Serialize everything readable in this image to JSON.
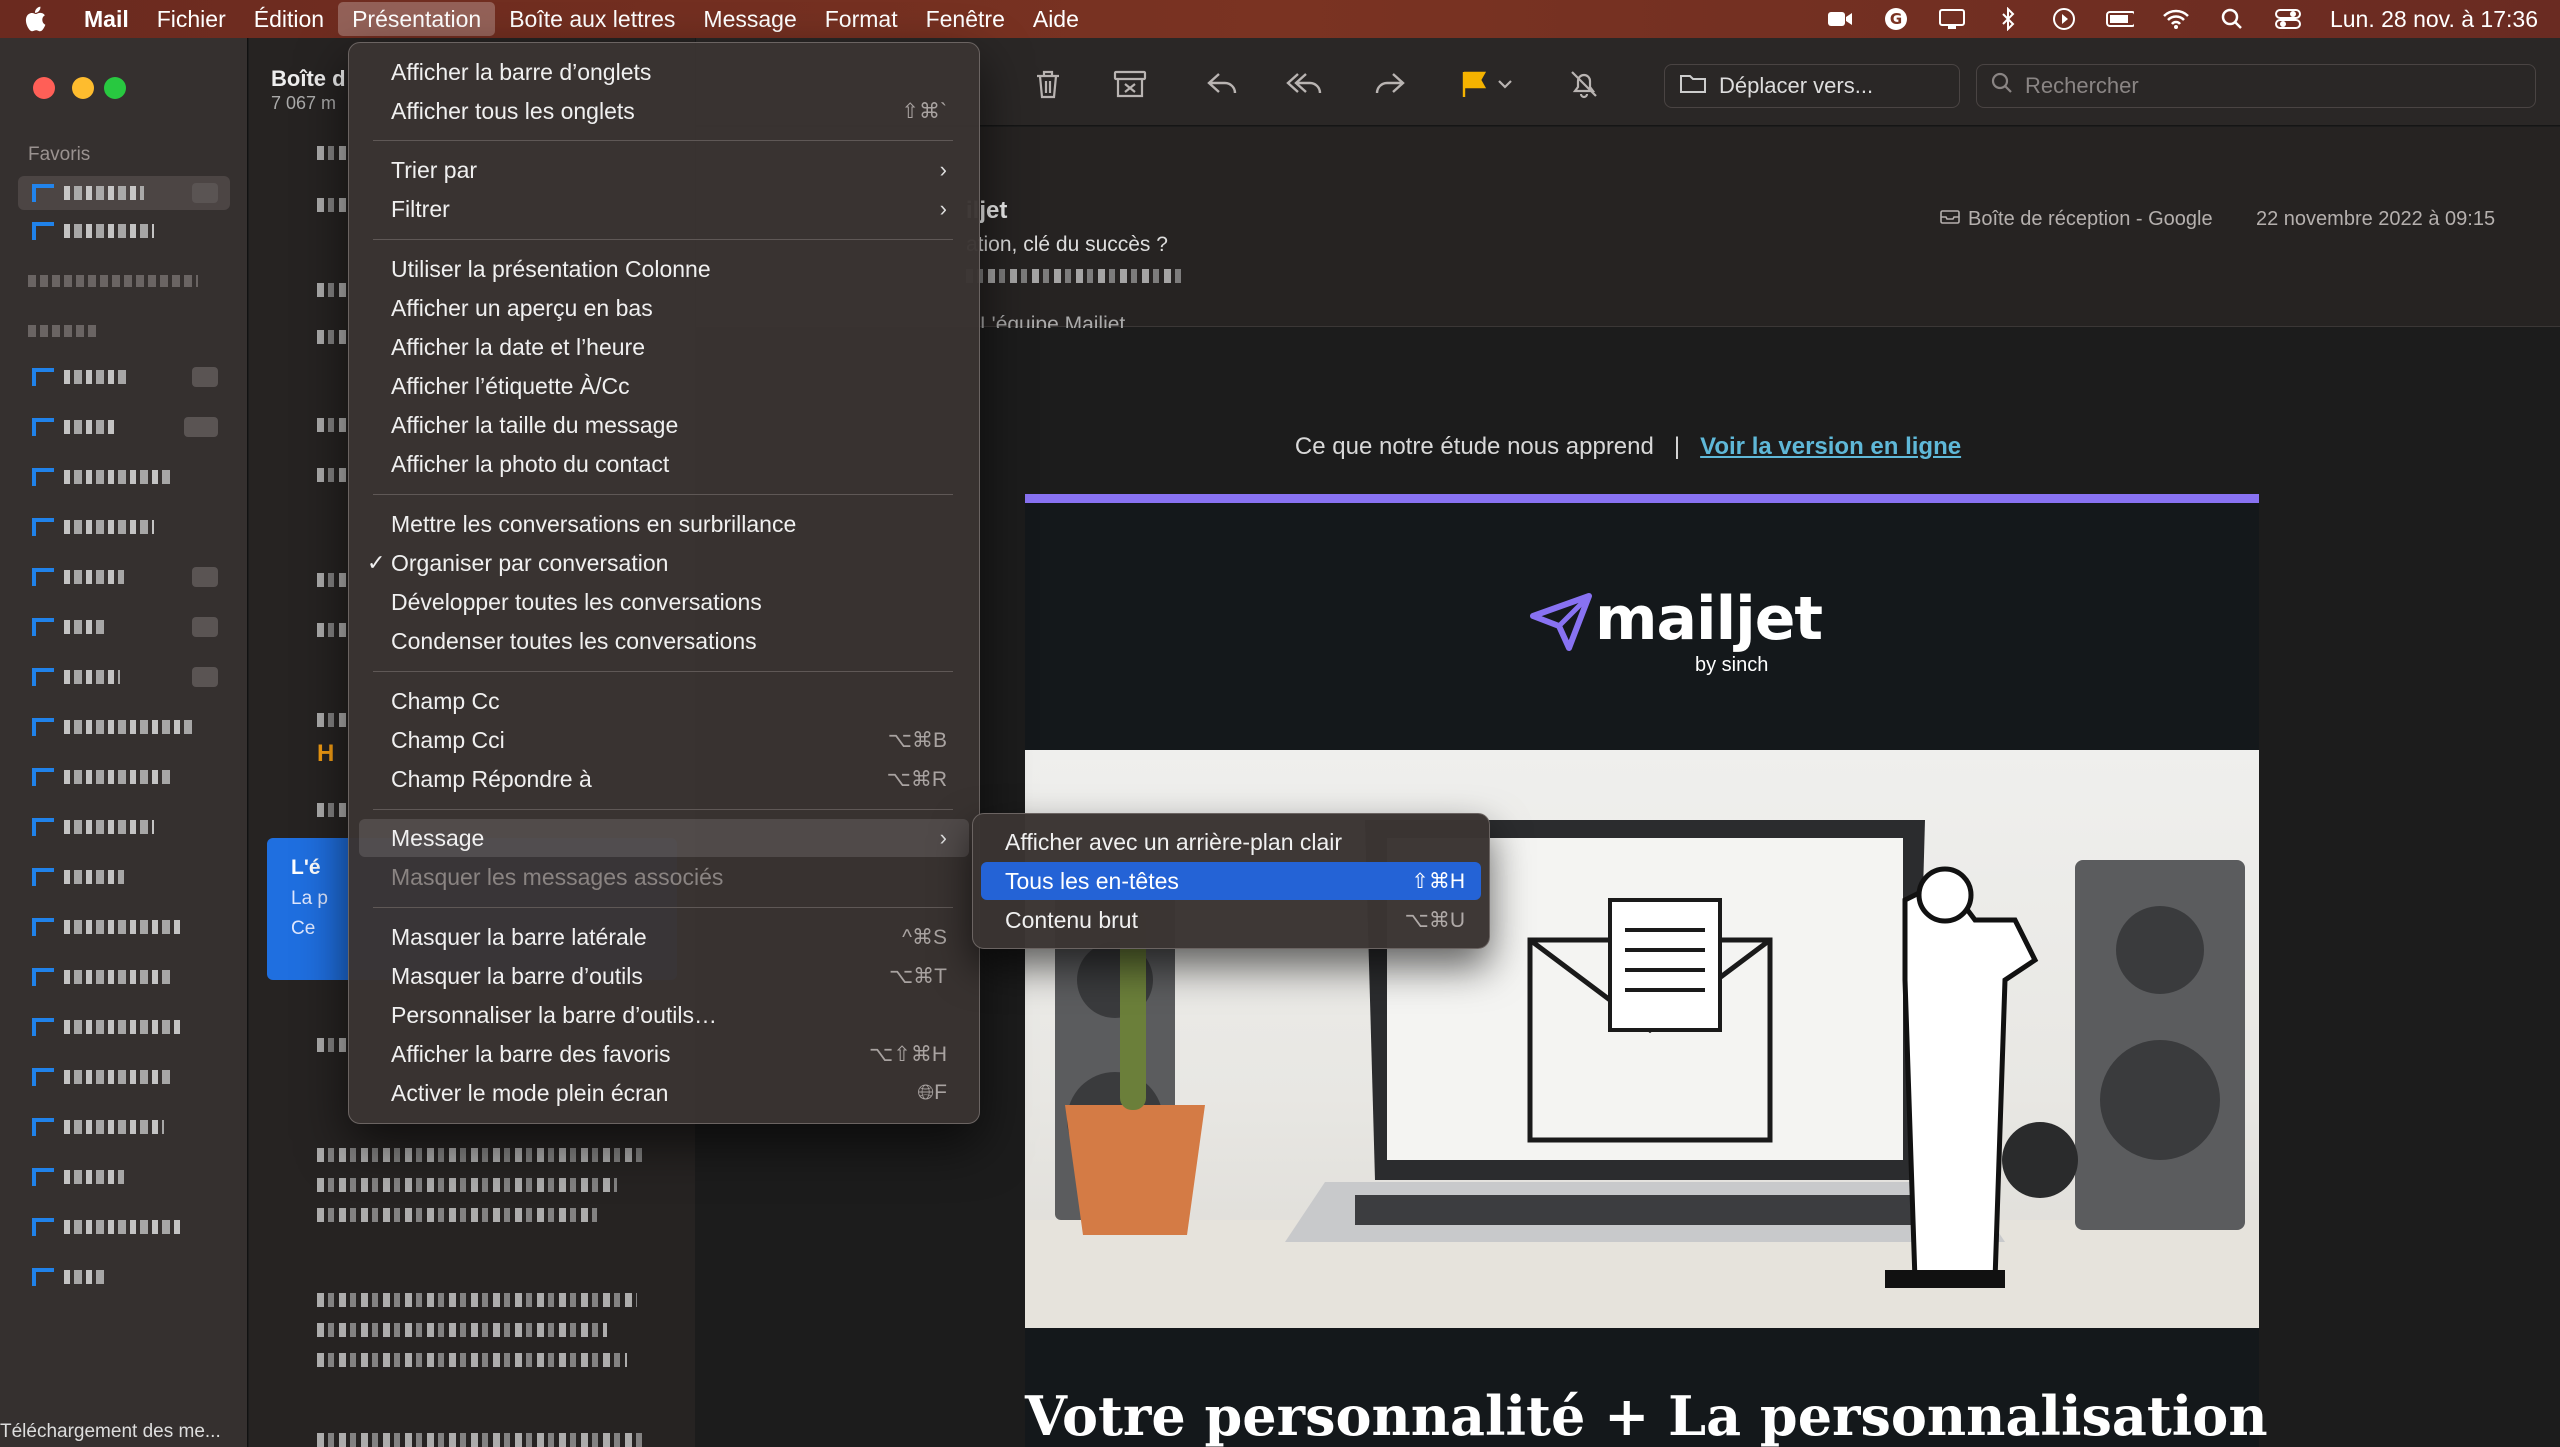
{
  "menubar": {
    "apple": "",
    "items": [
      "Mail",
      "Fichier",
      "Édition",
      "Présentation",
      "Boîte aux lettres",
      "Message",
      "Format",
      "Fenêtre",
      "Aide"
    ],
    "clock": "Lun. 28 nov. à 17:36"
  },
  "sidebar": {
    "favorites_label": "Favoris",
    "status": "Téléchargement des me..."
  },
  "message_list": {
    "title": "Boîte d",
    "count": "7 067 m",
    "selected": {
      "line1": "L'é",
      "line2": "La p",
      "line3": "Ce"
    },
    "orange_letter": "H"
  },
  "toolbar": {
    "move_label": "Déplacer vers...",
    "search_placeholder": "Rechercher"
  },
  "message_header": {
    "from": "iljet",
    "subject": "ation, clé du succès ?",
    "sender_line": "L'équipe Mailjet",
    "mailbox": "Boîte de réception - Google",
    "date": "22 novembre 2022 à 09:15"
  },
  "email": {
    "topline_text": "Ce que notre étude nous apprend",
    "separator": "|",
    "online_link": "Voir la version en ligne",
    "logo_word": "mailjet",
    "logo_by": "by sinch",
    "headline": "Votre personnalité + La personnalisation"
  },
  "view_menu": {
    "items": [
      {
        "label": "Afficher la barre d’onglets",
        "shortcut": ""
      },
      {
        "label": "Afficher tous les onglets",
        "shortcut": "⇧⌘`"
      },
      {
        "label": "Trier par",
        "submenu": true
      },
      {
        "label": "Filtrer",
        "submenu": true
      },
      {
        "label": "Utiliser la présentation Colonne",
        "shortcut": ""
      },
      {
        "label": "Afficher un aperçu en bas",
        "shortcut": ""
      },
      {
        "label": "Afficher la date et l’heure",
        "shortcut": ""
      },
      {
        "label": "Afficher l’étiquette À/Cc",
        "shortcut": ""
      },
      {
        "label": "Afficher la taille du message",
        "shortcut": ""
      },
      {
        "label": "Afficher la photo du contact",
        "shortcut": ""
      },
      {
        "label": "Mettre les conversations en surbrillance",
        "shortcut": ""
      },
      {
        "label": "Organiser par conversation",
        "checked": true
      },
      {
        "label": "Développer toutes les conversations",
        "shortcut": ""
      },
      {
        "label": "Condenser toutes les conversations",
        "shortcut": ""
      },
      {
        "label": "Champ Cc",
        "shortcut": ""
      },
      {
        "label": "Champ Cci",
        "shortcut": "⌥⌘B"
      },
      {
        "label": "Champ Répondre à",
        "shortcut": "⌥⌘R"
      },
      {
        "label": "Message",
        "submenu": true,
        "highlighted": true
      },
      {
        "label": "Masquer les messages associés",
        "disabled": true
      },
      {
        "label": "Masquer la barre latérale",
        "shortcut": "^⌘S"
      },
      {
        "label": "Masquer la barre d’outils",
        "shortcut": "⌥⌘T"
      },
      {
        "label": "Personnaliser la barre d’outils…",
        "shortcut": ""
      },
      {
        "label": "Afficher la barre des favoris",
        "shortcut": "⌥⇧⌘H"
      },
      {
        "label": "Activer le mode plein écran",
        "shortcut": "F"
      }
    ],
    "checkmark": "✓",
    "arrow": "›"
  },
  "message_submenu": {
    "items": [
      {
        "label": "Afficher avec un arrière-plan clair",
        "shortcut": ""
      },
      {
        "label": "Tous les en-têtes",
        "shortcut": "⇧⌘H",
        "active": true
      },
      {
        "label": "Contenu brut",
        "shortcut": "⌥⌘U"
      }
    ]
  },
  "colors": {
    "menubar_bg": "#7a3322",
    "accent_blue": "#2463d6",
    "mailjet_purple": "#8872f2",
    "flag": "#f5b300",
    "link": "#5fb8d8"
  }
}
